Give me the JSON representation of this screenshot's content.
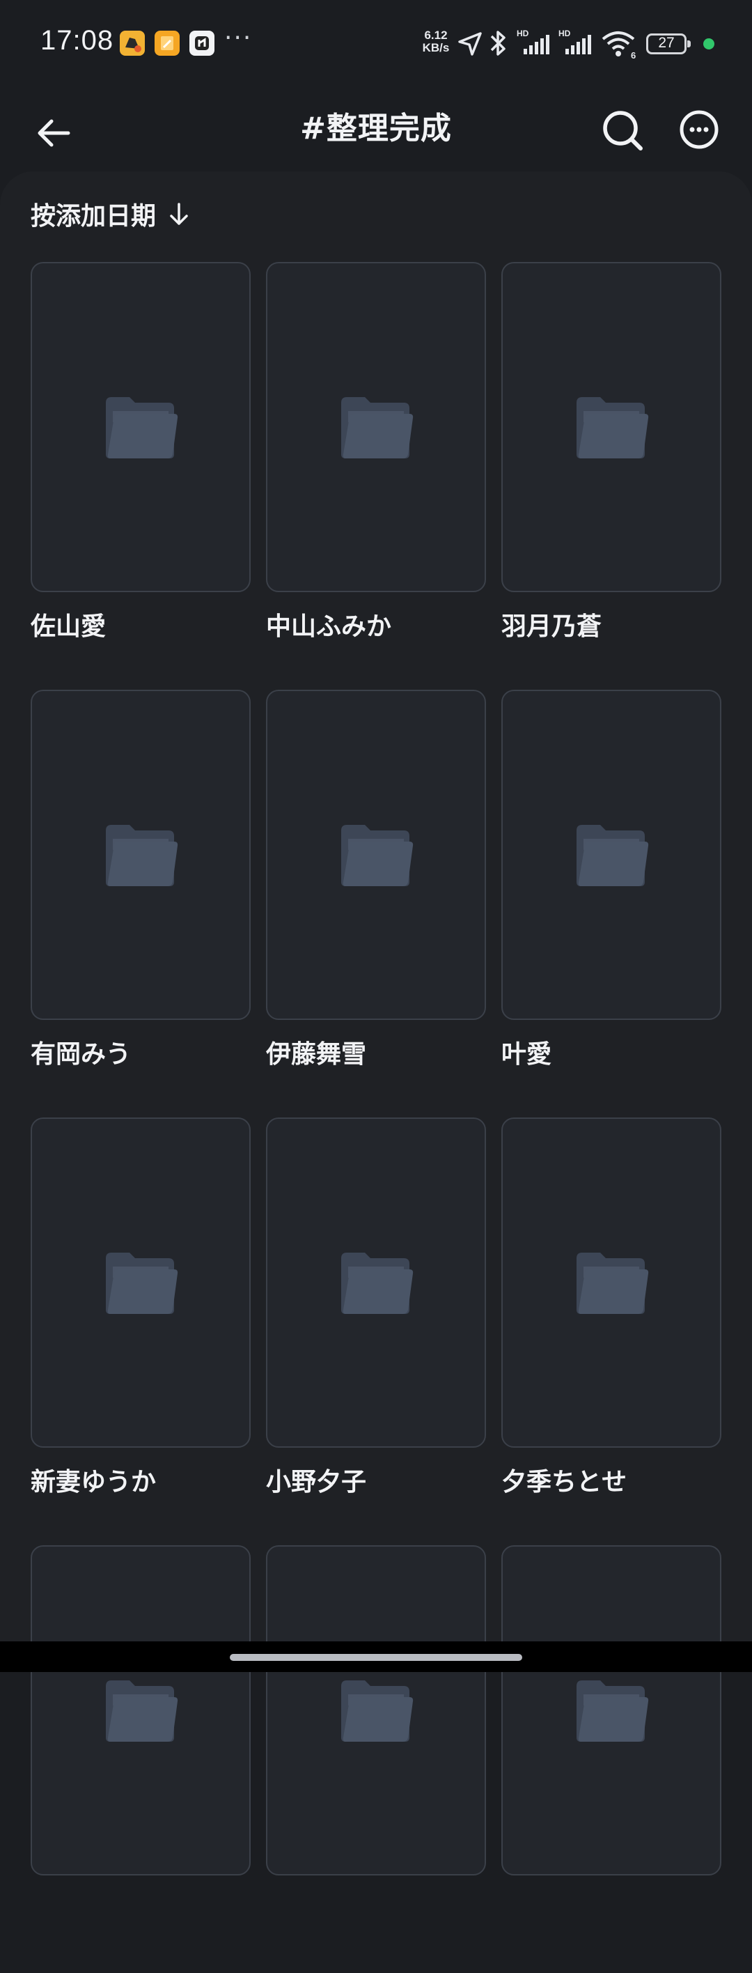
{
  "status_bar": {
    "time": "17:08",
    "net_speed_value": "6.12",
    "net_speed_unit": "KB/s",
    "battery_level": "27",
    "icons": [
      "app-notification-icon",
      "notes-icon",
      "app-icon",
      "more-dots-icon",
      "location-arrow-icon",
      "bluetooth-icon",
      "hd-signal-icon",
      "hd-signal-icon",
      "wifi-6-icon",
      "battery-icon",
      "green-dot-indicator"
    ]
  },
  "header": {
    "title": "#整理完成",
    "back_icon": "arrow-left-icon",
    "search_icon": "search-icon",
    "more_icon": "more-circle-icon"
  },
  "sort": {
    "label": "按添加日期",
    "icon": "arrow-down-icon"
  },
  "folders": [
    {
      "name": "佐山愛"
    },
    {
      "name": "中山ふみか"
    },
    {
      "name": "羽月乃蒼"
    },
    {
      "name": "有岡みう"
    },
    {
      "name": "伊藤舞雪"
    },
    {
      "name": "叶愛"
    },
    {
      "name": "新妻ゆうか"
    },
    {
      "name": "小野夕子"
    },
    {
      "name": "夕季ちとせ"
    },
    {
      "name": ""
    },
    {
      "name": ""
    },
    {
      "name": ""
    }
  ],
  "colors": {
    "background": "#1b1d21",
    "panel": "#1f2125",
    "card": "#23262c",
    "card_border": "#3b4049",
    "folder_icon": "#4a5567",
    "text": "#f2f3f5",
    "status_dot": "#31c76b"
  }
}
